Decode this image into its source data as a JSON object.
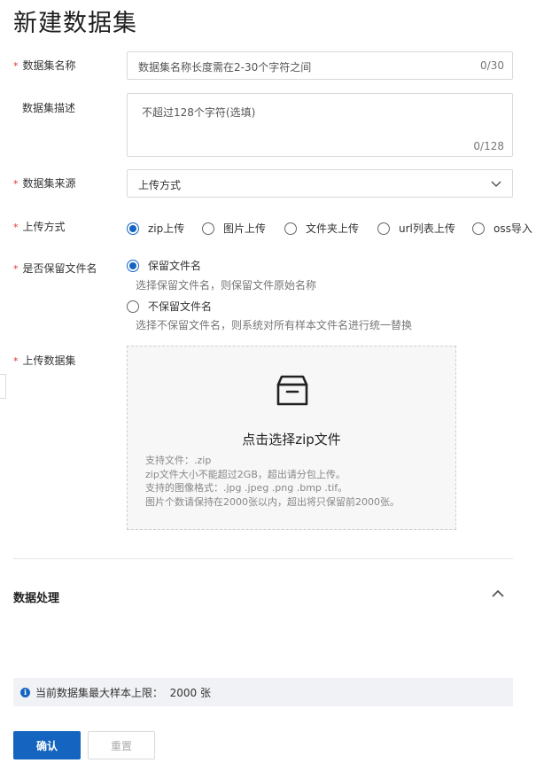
{
  "title": "新建数据集",
  "fields": {
    "name": {
      "label": "数据集名称",
      "required": "*",
      "placeholder": "数据集名称长度需在2-30个字符之间",
      "count": "0/30"
    },
    "desc": {
      "label": "数据集描述",
      "placeholder": "不超过128个字符(选填)",
      "count": "0/128"
    },
    "source": {
      "label": "数据集来源",
      "required": "*",
      "value": "上传方式"
    },
    "upload_method": {
      "label": "上传方式",
      "required": "*",
      "options": [
        "zip上传",
        "图片上传",
        "文件夹上传",
        "url列表上传",
        "oss导入"
      ],
      "selected": "zip上传"
    },
    "keep_name": {
      "label": "是否保留文件名",
      "required": "*",
      "options": [
        {
          "label": "保留文件名",
          "hint": "选择保留文件名，则保留文件原始名称"
        },
        {
          "label": "不保留文件名",
          "hint": "选择不保留文件名，则系统对所有样本文件名进行统一替换"
        }
      ],
      "selected": "保留文件名"
    },
    "upload_dataset": {
      "label": "上传数据集",
      "required": "*",
      "main_text": "点击选择zip文件",
      "lines": [
        "支持文件：.zip",
        "zip文件大小不能超过2GB，超出请分包上传。",
        "支持的图像格式：.jpg .jpeg .png .bmp .tif。",
        "图片个数请保持在2000张以内，超出将只保留前2000张。"
      ]
    }
  },
  "section": {
    "title": "数据处理"
  },
  "notice": {
    "text": "当前数据集最大样本上限：  2000 张"
  },
  "buttons": {
    "confirm": "确认",
    "reset": "重置"
  },
  "colors": {
    "primary": "#1565c0",
    "required": "#e53935"
  }
}
